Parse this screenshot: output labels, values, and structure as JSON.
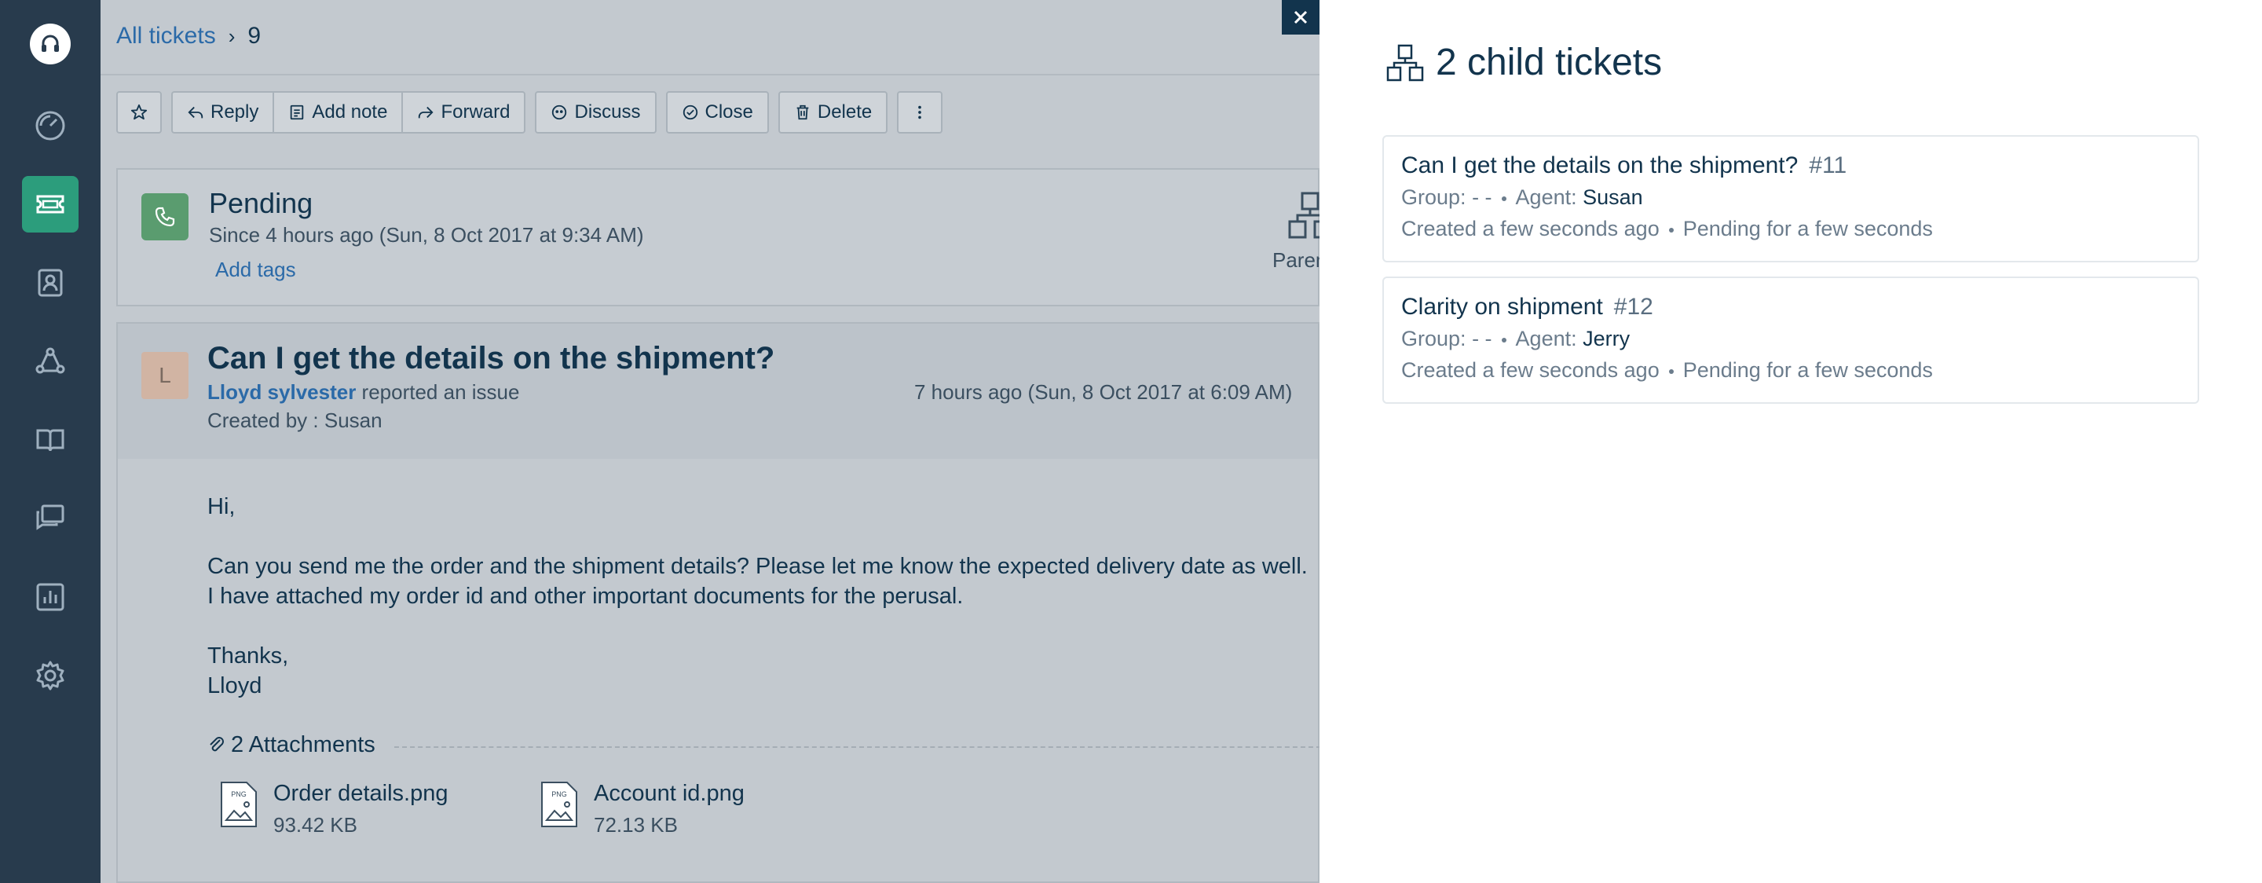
{
  "breadcrumb": {
    "link": "All tickets",
    "current": "9"
  },
  "toolbar": {
    "reply": "Reply",
    "add_note": "Add note",
    "forward": "Forward",
    "discuss": "Discuss",
    "close": "Close",
    "delete": "Delete"
  },
  "status": {
    "title": "Pending",
    "since": "Since 4 hours ago (Sun, 8 Oct 2017 at 9:34 AM)",
    "add_tags": "Add tags",
    "parent_label": "Parent"
  },
  "conversation": {
    "avatar_initial": "L",
    "subject": "Can I get the details on the shipment?",
    "requester": "Lloyd sylvester",
    "reported": "reported an issue",
    "created_by": "Created by : Susan",
    "time": "7 hours ago (Sun, 8 Oct 2017 at 6:09 AM)",
    "body_greeting": "Hi,",
    "body_line1": "Can you send me the order and the shipment details? Please let me know the expected delivery date as well.",
    "body_line2": "I have attached my order id and other important documents for the perusal.",
    "body_signoff1": "Thanks,",
    "body_signoff2": "Lloyd",
    "attachments_label": "2 Attachments",
    "attachments": [
      {
        "name": "Order details.png",
        "size": "93.42 KB",
        "icon_label": "PNG"
      },
      {
        "name": "Account id.png",
        "size": "72.13 KB",
        "icon_label": "PNG"
      }
    ]
  },
  "panel": {
    "title": "2 child tickets",
    "tickets": [
      {
        "title": "Can I get the details on the shipment?",
        "id": "#11",
        "group_label": "Group:",
        "group": "- -",
        "agent_label": "Agent:",
        "agent": "Susan",
        "created": "Created a few seconds ago",
        "pending": "Pending for a few seconds"
      },
      {
        "title": "Clarity on shipment",
        "id": "#12",
        "group_label": "Group:",
        "group": "- -",
        "agent_label": "Agent:",
        "agent": "Jerry",
        "created": "Created a few seconds ago",
        "pending": "Pending for a few seconds"
      }
    ]
  },
  "colors": {
    "nav_bg": "#283b4d",
    "nav_active": "#2c9d7c",
    "link": "#2b6aa8",
    "text": "#12344d"
  },
  "icons": {
    "nav": [
      "headset-logo-icon",
      "dashboard-icon",
      "tickets-icon",
      "contacts-icon",
      "groups-icon",
      "book-icon",
      "chat-icon",
      "reports-icon",
      "settings-icon"
    ]
  }
}
